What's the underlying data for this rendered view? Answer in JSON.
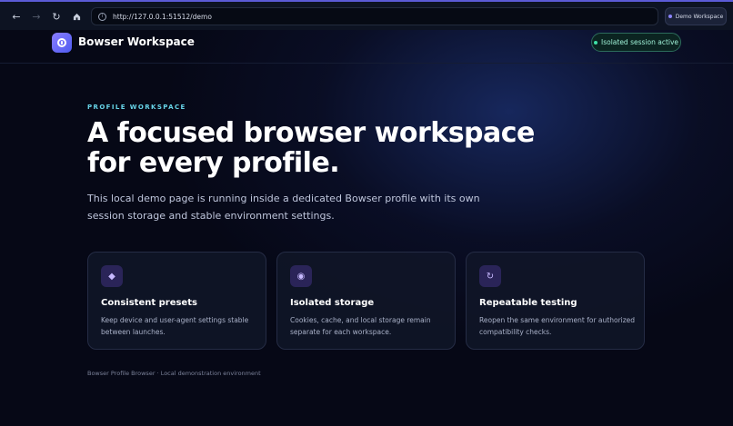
{
  "browser": {
    "url": "http://127.0.0.1:51512/demo",
    "profile_label": "Demo Workspace",
    "nav_icons": [
      "back-icon",
      "forward-icon",
      "reload-icon",
      "home-icon"
    ]
  },
  "header": {
    "brand": "Bowser Workspace",
    "session_status": "Isolated session active"
  },
  "hero": {
    "eyebrow": "PROFILE WORKSPACE",
    "headline": "A focused browser workspace for every profile.",
    "lede": "This local demo page is running inside a dedicated Bowser profile with its own session storage and stable environment settings."
  },
  "features": [
    {
      "icon": "diamond-icon",
      "title": "Consistent presets",
      "description": "Keep device and user-agent settings stable between launches."
    },
    {
      "icon": "target-icon",
      "title": "Isolated storage",
      "description": "Cookies, cache, and local storage remain separate for each workspace."
    },
    {
      "icon": "refresh-icon",
      "title": "Repeatable testing",
      "description": "Reopen the same environment for authorized compatibility checks."
    }
  ],
  "footer": "Bowser Profile Browser · Local demonstration environment",
  "colors": {
    "accent": "#8a7dff",
    "eyebrow": "#67d4e8",
    "session_dot": "#3ee0a8",
    "background": "#060816"
  }
}
